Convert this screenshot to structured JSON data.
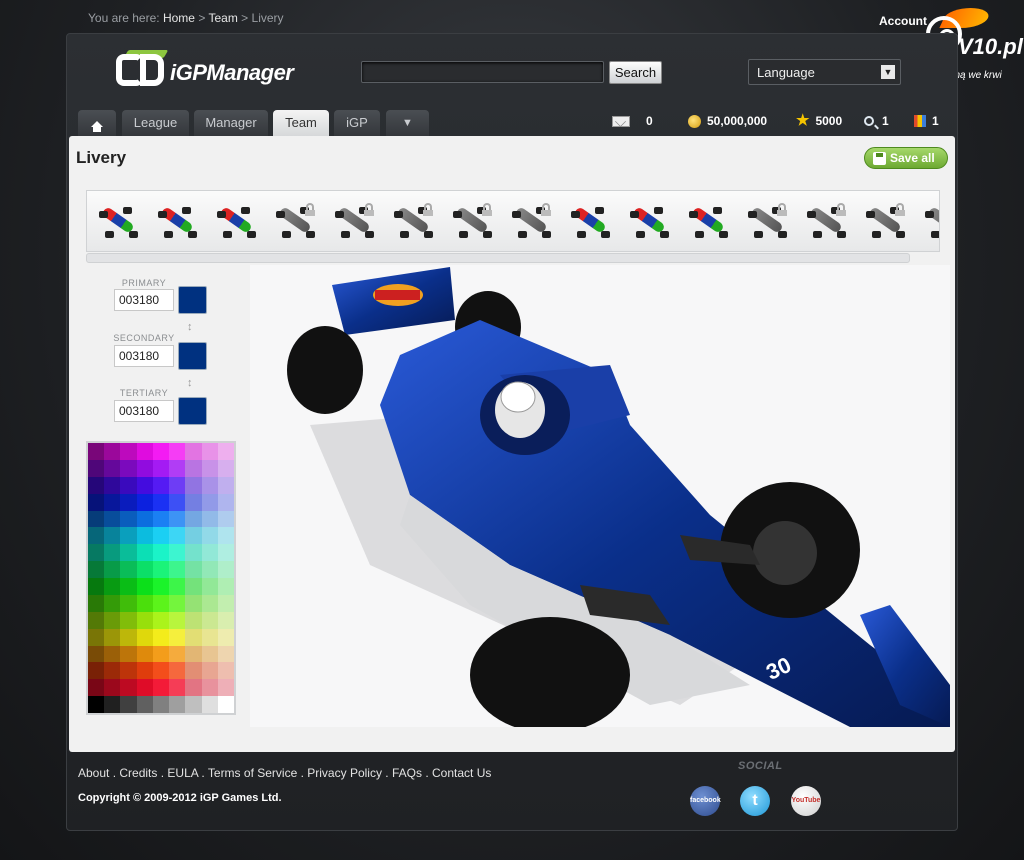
{
  "breadcrumb": {
    "prefix": "You are here:",
    "items": [
      "Home",
      "Team",
      "Livery"
    ],
    "separator": ">"
  },
  "account_label": "Account",
  "watermark": {
    "name": "V10.pl",
    "tagline": "z benzyną we krwi"
  },
  "brand": {
    "name": "iGPManager",
    "accent": "#8dc63f"
  },
  "search": {
    "value": "",
    "button_label": "Search"
  },
  "language": {
    "selected": "Language"
  },
  "tabs": [
    {
      "label": "",
      "icon": "home-icon",
      "active": false
    },
    {
      "label": "League",
      "active": false
    },
    {
      "label": "Manager",
      "active": false
    },
    {
      "label": "Team",
      "active": true
    },
    {
      "label": "iGP",
      "active": false
    },
    {
      "label": "▼",
      "active": false
    }
  ],
  "stats": {
    "messages": "0",
    "money": "50,000,000",
    "tokens": "5000",
    "scouts": "1",
    "reports": "1"
  },
  "page": {
    "title": "Livery",
    "save_label": "Save all"
  },
  "livery_thumbnails": [
    {
      "style": "red-blue-green",
      "locked": false
    },
    {
      "style": "red-blue-green",
      "locked": false
    },
    {
      "style": "red-blue-green",
      "locked": false
    },
    {
      "style": "grey",
      "locked": true
    },
    {
      "style": "grey",
      "locked": true
    },
    {
      "style": "grey",
      "locked": true
    },
    {
      "style": "grey",
      "locked": true
    },
    {
      "style": "grey",
      "locked": true
    },
    {
      "style": "red-blue-green",
      "locked": false
    },
    {
      "style": "red-blue-green",
      "locked": false
    },
    {
      "style": "red-blue-green",
      "locked": false
    },
    {
      "style": "grey",
      "locked": true
    },
    {
      "style": "grey",
      "locked": true
    },
    {
      "style": "grey",
      "locked": true
    },
    {
      "style": "grey",
      "locked": true
    }
  ],
  "colors": {
    "primary": {
      "label": "PRIMARY",
      "value": "003180",
      "swatch": "#003180"
    },
    "secondary": {
      "label": "SECONDARY",
      "value": "003180",
      "swatch": "#003180"
    },
    "tertiary": {
      "label": "TERTIARY",
      "value": "003180",
      "swatch": "#003180"
    }
  },
  "car": {
    "number": "30",
    "body_color": "#0a2f8a"
  },
  "footer": {
    "links": [
      "About",
      "Credits",
      "EULA",
      "Terms of Service",
      "Privacy Policy",
      "FAQs",
      "Contact Us"
    ],
    "copyright": "Copyright © 2009-2012 iGP Games Ltd.",
    "social_label": "SOCIAL",
    "social": [
      {
        "name": "facebook",
        "label": "facebook"
      },
      {
        "name": "twitter",
        "label": "t"
      },
      {
        "name": "youtube",
        "label": "YouTube"
      }
    ]
  }
}
